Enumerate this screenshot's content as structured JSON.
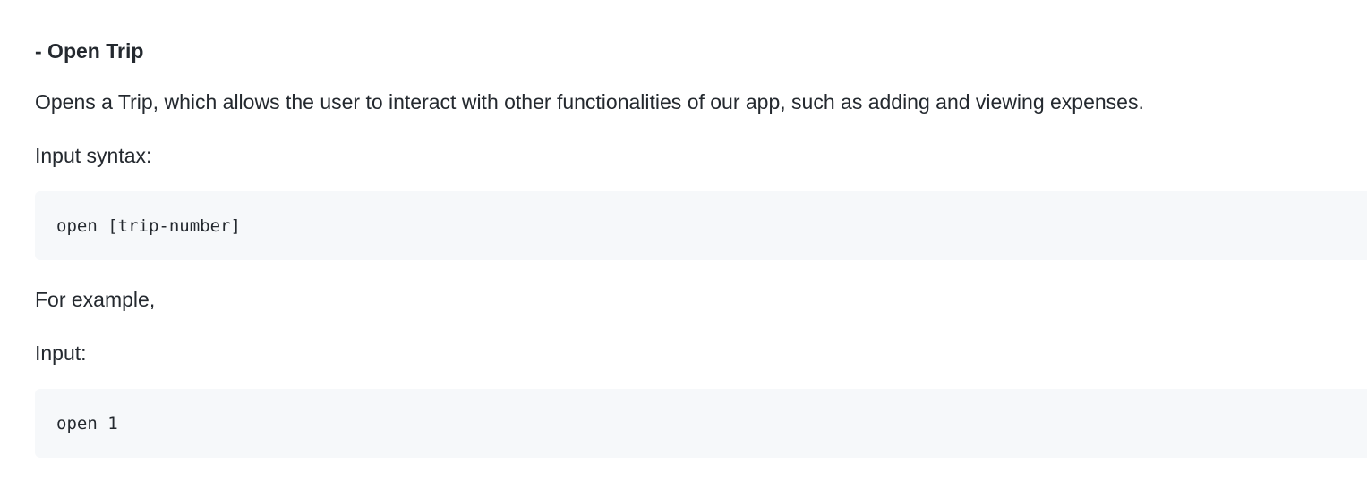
{
  "section": {
    "heading": "- Open Trip",
    "description": "Opens a Trip, which allows the user to interact with other functionalities of our app, such as adding and viewing expenses.",
    "syntax_label": "Input syntax:",
    "syntax_code": "open [trip-number]",
    "example_label": "For example,",
    "input_label": "Input:",
    "input_code": "open 1"
  }
}
